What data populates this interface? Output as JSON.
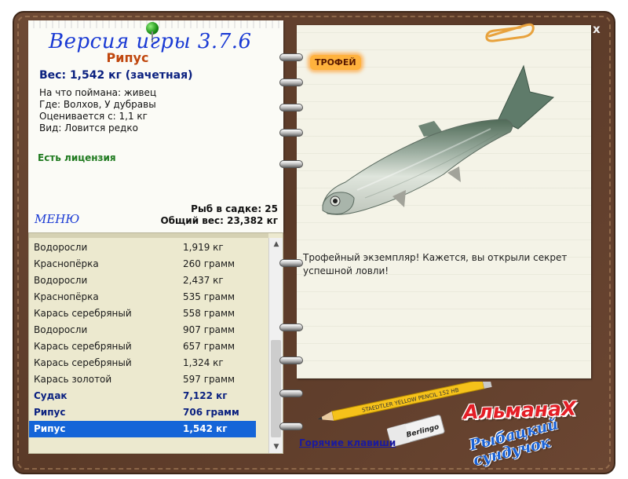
{
  "window": {
    "close_label": "x"
  },
  "card": {
    "version_text": "Версия игры 3.7.6",
    "fish_name": "Рипус",
    "weight_line": "Вес: 1,542 кг (зачетная)",
    "info": [
      "На что поймана: живец",
      "Где: Волхов, У дубравы",
      "Оценивается с: 1,1 кг",
      "Вид: Ловится редко"
    ],
    "license": "Есть лицензия",
    "menu_label": "МЕНЮ",
    "in_cage": "Рыб в садке: 25",
    "total_weight": "Общий вес: 23,382 кг"
  },
  "catch_list": {
    "rows": [
      {
        "name": "Водоросли",
        "weight": "1,919 кг",
        "style": "normal"
      },
      {
        "name": "Краснопёрка",
        "weight": "260 грамм",
        "style": "normal"
      },
      {
        "name": "Водоросли",
        "weight": "2,437 кг",
        "style": "normal"
      },
      {
        "name": "Краснопёрка",
        "weight": "535 грамм",
        "style": "normal"
      },
      {
        "name": "Карась серебряный",
        "weight": "558 грамм",
        "style": "normal"
      },
      {
        "name": "Водоросли",
        "weight": "907 грамм",
        "style": "normal"
      },
      {
        "name": "Карась серебряный",
        "weight": "657 грамм",
        "style": "normal"
      },
      {
        "name": "Карась серебряный",
        "weight": "1,324 кг",
        "style": "normal"
      },
      {
        "name": "Карась золотой",
        "weight": "597 грамм",
        "style": "normal"
      },
      {
        "name": "Судак",
        "weight": "7,122 кг",
        "style": "bold"
      },
      {
        "name": "Рипус",
        "weight": "706 грамм",
        "style": "bold"
      },
      {
        "name": "Рипус",
        "weight": "1,542 кг",
        "style": "selected"
      }
    ],
    "scroll_position": 0.95
  },
  "trophy": {
    "badge": "ТРОФЕЙ",
    "caption": "Трофейный экземпляр! Кажется, вы открыли секрет успешной ловли!"
  },
  "footer": {
    "hotkeys": "Горячие клавиши",
    "pencil_text": "STAEDTLER YELLOW PENCIL 152 HB",
    "eraser_text": "Berlingo",
    "logo_title": "АльманаХ",
    "logo_subtitle": "Рыбацкий сундучок"
  },
  "colors": {
    "selected_row": "#1565d8",
    "bold_row_text": "#0b2180",
    "fish_name": "#c0470e",
    "license": "#1f7a1f",
    "version": "#1a3ad4"
  },
  "icons": {
    "close": "close-icon",
    "pin": "pin-icon",
    "paperclip": "paperclip-icon",
    "scroll_up": "arrow-up-icon",
    "scroll_down": "arrow-down-icon"
  }
}
